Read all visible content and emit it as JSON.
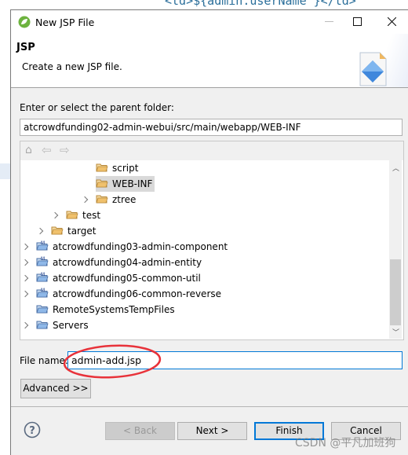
{
  "background": {
    "code_text": "<td>${admin.userName }</td>",
    "watermark": "CSDN @平凡加班狗"
  },
  "window": {
    "title": "New JSP File",
    "icon": "spring-leaf-icon"
  },
  "header": {
    "title": "JSP",
    "description": "Create a new JSP file.",
    "image": "jsp-file-wizard-icon"
  },
  "parent_folder": {
    "label": "Enter or select the parent folder:",
    "value": "atcrowdfunding02-admin-webui/src/main/webapp/WEB-INF"
  },
  "tree": {
    "toolbar": [
      "home-icon",
      "back-arrow-icon",
      "forward-arrow-icon"
    ],
    "items": [
      {
        "label": "script",
        "type": "folder",
        "indent": 4,
        "expandable": false
      },
      {
        "label": "WEB-INF",
        "type": "folder",
        "indent": 4,
        "expandable": false,
        "selected": true
      },
      {
        "label": "ztree",
        "type": "folder",
        "indent": 4,
        "expandable": true
      },
      {
        "label": "test",
        "type": "folder",
        "indent": 2,
        "expandable": true
      },
      {
        "label": "target",
        "type": "folder",
        "indent": 1,
        "expandable": true
      },
      {
        "label": "atcrowdfunding03-admin-component",
        "type": "maven-project",
        "indent": 0,
        "expandable": true
      },
      {
        "label": "atcrowdfunding04-admin-entity",
        "type": "maven-project",
        "indent": 0,
        "expandable": true
      },
      {
        "label": "atcrowdfunding05-common-util",
        "type": "maven-project",
        "indent": 0,
        "expandable": true
      },
      {
        "label": "atcrowdfunding06-common-reverse",
        "type": "maven-project",
        "indent": 0,
        "expandable": true
      },
      {
        "label": "RemoteSystemsTempFiles",
        "type": "project",
        "indent": 0,
        "expandable": false
      },
      {
        "label": "Servers",
        "type": "project",
        "indent": 0,
        "expandable": true
      }
    ]
  },
  "file_name": {
    "label": "File name:",
    "value": "admin-add.jsp"
  },
  "buttons": {
    "advanced": "Advanced >>",
    "back": "< Back",
    "next": "Next >",
    "finish": "Finish",
    "cancel": "Cancel"
  },
  "colors": {
    "annotation": "#e8323a",
    "focus": "#0078d7",
    "selected_row": "#d9d9d9"
  }
}
